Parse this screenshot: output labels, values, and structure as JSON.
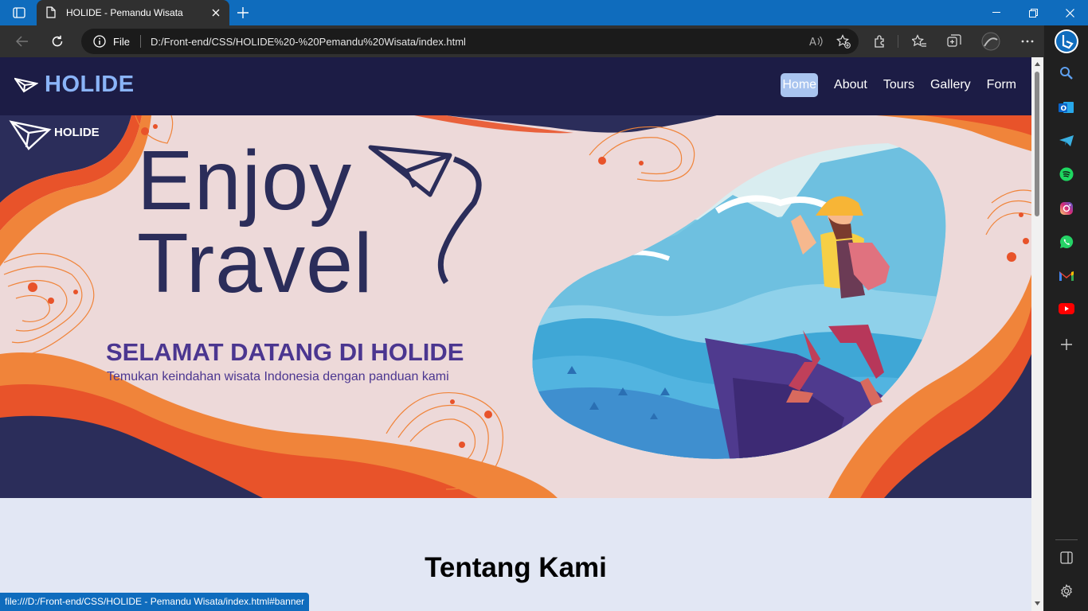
{
  "browser": {
    "tab": {
      "title": "HOLIDE - Pemandu Wisata"
    },
    "address": {
      "scheme_label": "File",
      "url": "D:/Front-end/CSS/HOLIDE%20-%20Pemandu%20Wisata/index.html"
    },
    "status_url": "file:///D:/Front-end/CSS/HOLIDE - Pemandu Wisata/index.html#banner",
    "sidebar_icons": [
      "search-icon",
      "outlook-icon",
      "telegram-icon",
      "spotify-icon",
      "instagram-icon",
      "whatsapp-icon",
      "gmail-icon",
      "youtube-icon",
      "add-icon",
      "split-screen-icon",
      "settings-icon"
    ]
  },
  "site": {
    "brand": "HOLIDE",
    "nav": [
      {
        "label": "Home",
        "active": true
      },
      {
        "label": "About",
        "active": false
      },
      {
        "label": "Tours",
        "active": false
      },
      {
        "label": "Gallery",
        "active": false
      },
      {
        "label": "Form",
        "active": false
      }
    ],
    "banner": {
      "logo_text": "HOLIDE",
      "headline_line1": "Enjoy",
      "headline_line2": "Travel",
      "welcome": "SELAMAT DATANG DI HOLIDE",
      "tagline": "Temukan keindahan wisata Indonesia dengan panduan kami"
    },
    "about": {
      "title": "Tentang Kami"
    }
  },
  "colors": {
    "browser_accent": "#0f6cbd",
    "header_bg": "#1c1c45",
    "brand": "#8ab4f8",
    "banner_bg": "#edd9d9",
    "orange": "#f0843a",
    "red_orange": "#e8532a",
    "navy": "#2b2d5a",
    "purple_text": "#4b3690",
    "about_bg": "#e2e7f4"
  }
}
